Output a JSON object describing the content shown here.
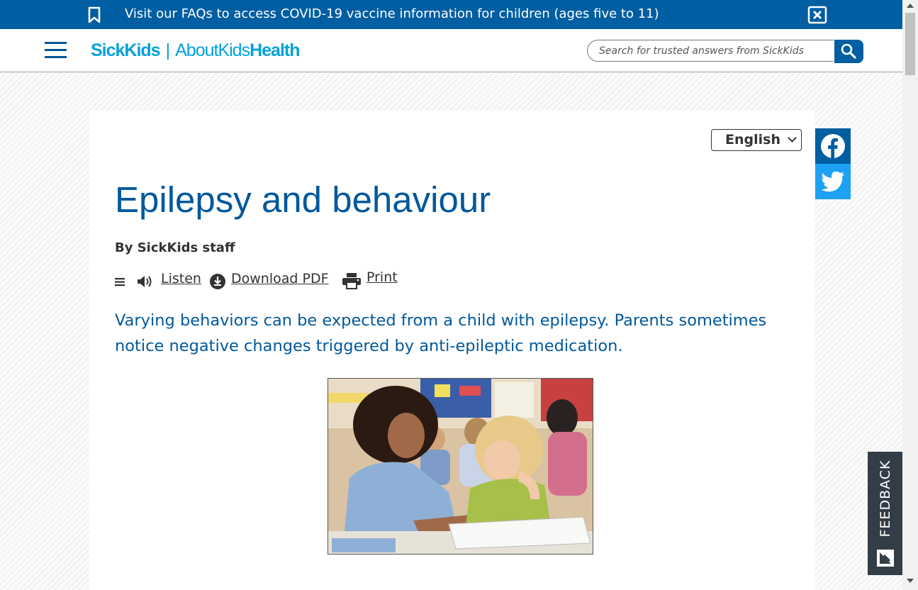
{
  "banner": {
    "text": "Visit our FAQs to access COVID-19 vaccine information for children (ages five to 11)",
    "bookmark_icon": "bookmark-icon",
    "close_icon": "close-box-icon"
  },
  "header": {
    "logo": {
      "sickkids": "SickKids",
      "separator": "|",
      "about": "AboutKids",
      "health": "Health"
    },
    "menu_icon": "hamburger-menu-icon",
    "search": {
      "placeholder": "Search for trusted answers from SickKids",
      "value": ""
    },
    "search_icon": "search-icon"
  },
  "article": {
    "language": "English",
    "title": "Epilepsy and behaviour",
    "byline": "By SickKids staff",
    "tools": {
      "listen": "Listen",
      "download": "Download PDF",
      "print": "Print"
    },
    "lead": "Varying behaviors can be expected from a child with epilepsy. Parents sometimes notice negative changes triggered by anti-epileptic medication.",
    "image_subject": "teacher-helping-student-photo"
  },
  "social": {
    "facebook_icon": "facebook-icon",
    "twitter_icon": "twitter-icon"
  },
  "feedback": {
    "label": "FEEDBACK",
    "icon": "feedback-icon"
  },
  "colors": {
    "brand_blue": "#005ea2",
    "title_blue": "#00589c",
    "logo_cyan": "#00a1dc",
    "twitter_blue": "#1da1f2",
    "feedback_bg": "#333d47"
  }
}
